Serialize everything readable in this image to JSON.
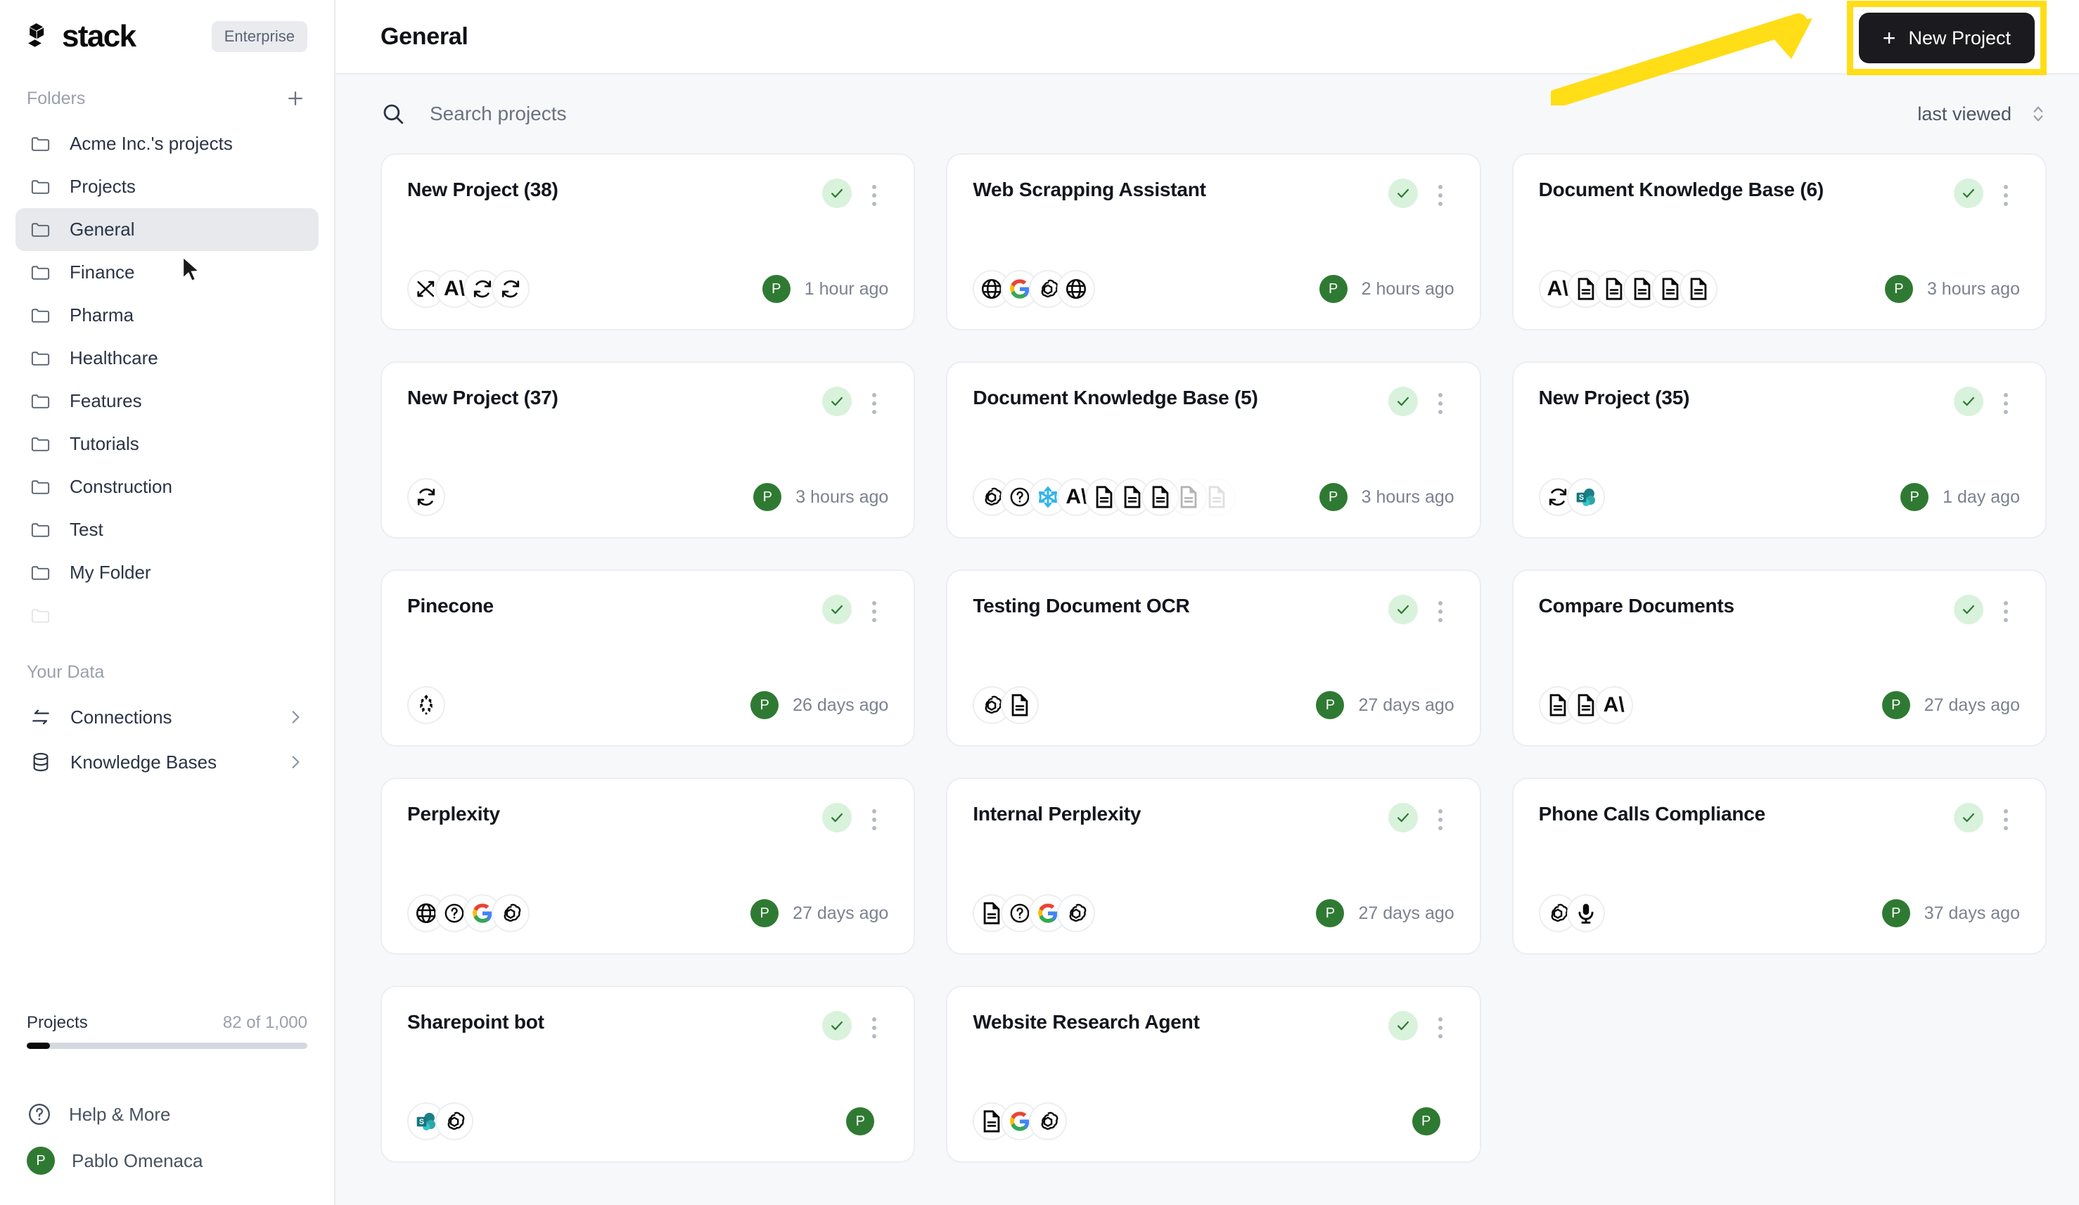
{
  "brand": {
    "name": "stack",
    "plan_badge": "Enterprise",
    "logo_icon": "stack-cubes-logo"
  },
  "sidebar": {
    "folders_label": "Folders",
    "add_folder_icon": "plus-icon",
    "folders": [
      {
        "label": "Acme Inc.'s projects",
        "icon": "folder-icon",
        "active": false
      },
      {
        "label": "Projects",
        "icon": "folder-icon",
        "active": false
      },
      {
        "label": "General",
        "icon": "folder-icon",
        "active": true
      },
      {
        "label": "Finance",
        "icon": "folder-icon",
        "active": false
      },
      {
        "label": "Pharma",
        "icon": "folder-icon",
        "active": false
      },
      {
        "label": "Healthcare",
        "icon": "folder-icon",
        "active": false
      },
      {
        "label": "Features",
        "icon": "folder-icon",
        "active": false
      },
      {
        "label": "Tutorials",
        "icon": "folder-icon",
        "active": false
      },
      {
        "label": "Construction",
        "icon": "folder-icon",
        "active": false
      },
      {
        "label": "Test",
        "icon": "folder-icon",
        "active": false
      },
      {
        "label": "My Folder",
        "icon": "folder-icon",
        "active": false
      }
    ],
    "your_data_label": "Your Data",
    "data_items": [
      {
        "label": "Connections",
        "icon": "arrows-exchange-icon",
        "chevron": "chevron-right-icon"
      },
      {
        "label": "Knowledge Bases",
        "icon": "database-icon",
        "chevron": "chevron-right-icon"
      }
    ],
    "quota": {
      "label": "Projects",
      "value": "82 of 1,000",
      "percent": 8.2
    },
    "help": {
      "label": "Help & More",
      "icon": "question-circle-icon"
    },
    "user": {
      "name": "Pablo Omenaca",
      "initial": "P",
      "avatar_color": "#2f7a32"
    }
  },
  "topbar": {
    "title": "General",
    "new_project_label": "New Project",
    "new_project_plus": "+",
    "highlight_color": "#FFDD17"
  },
  "toolbar": {
    "search_icon": "search-icon",
    "search_value": "",
    "search_placeholder": "Search projects",
    "sort_label": "last viewed",
    "sort_icon": "chevron-up-down-icon"
  },
  "status_badge_icon": "check-icon",
  "menu_icon": "three-dots-vertical-icon",
  "projects": [
    {
      "title": "New Project (38)",
      "timestamp": "1 hour ago",
      "owner_initial": "P",
      "icons": [
        "shuffle-icon",
        "anthropic-icon",
        "sync-icon",
        "sync-icon"
      ]
    },
    {
      "title": "Web Scrapping Assistant",
      "timestamp": "2 hours ago",
      "owner_initial": "P",
      "icons": [
        "globe-icon",
        "google-icon",
        "openai-icon",
        "globe-icon"
      ]
    },
    {
      "title": "Document Knowledge Base (6)",
      "timestamp": "3 hours ago",
      "owner_initial": "P",
      "icons": [
        "anthropic-icon",
        "document-icon",
        "document-icon",
        "document-icon",
        "document-icon",
        "document-icon"
      ]
    },
    {
      "title": "New Project (37)",
      "timestamp": "3 hours ago",
      "owner_initial": "P",
      "icons": [
        "sync-icon"
      ]
    },
    {
      "title": "Document Knowledge Base (5)",
      "timestamp": "3 hours ago",
      "owner_initial": "P",
      "icons": [
        "openai-icon",
        "question-icon",
        "snowflake-icon",
        "anthropic-icon",
        "document-icon",
        "document-icon",
        "document-icon",
        "document-icon-faded",
        "document-icon-faded2"
      ]
    },
    {
      "title": "New Project (35)",
      "timestamp": "1 day ago",
      "owner_initial": "P",
      "icons": [
        "sync-icon",
        "sharepoint-icon"
      ]
    },
    {
      "title": "Pinecone",
      "timestamp": "26 days ago",
      "owner_initial": "P",
      "icons": [
        "pinecone-icon"
      ]
    },
    {
      "title": "Testing Document OCR",
      "timestamp": "27 days ago",
      "owner_initial": "P",
      "icons": [
        "openai-icon",
        "document-icon"
      ]
    },
    {
      "title": "Compare Documents",
      "timestamp": "27 days ago",
      "owner_initial": "P",
      "icons": [
        "document-icon",
        "document-icon",
        "anthropic-icon"
      ]
    },
    {
      "title": "Perplexity",
      "timestamp": "27 days ago",
      "owner_initial": "P",
      "icons": [
        "globe-icon",
        "question-icon",
        "google-icon",
        "openai-icon"
      ]
    },
    {
      "title": "Internal Perplexity",
      "timestamp": "27 days ago",
      "owner_initial": "P",
      "icons": [
        "document-icon",
        "question-icon",
        "google-icon",
        "openai-icon"
      ]
    },
    {
      "title": "Phone Calls Compliance",
      "timestamp": "37 days ago",
      "owner_initial": "P",
      "icons": [
        "openai-icon",
        "microphone-icon"
      ]
    },
    {
      "title": "Sharepoint bot",
      "timestamp": "",
      "owner_initial": "P",
      "icons": [
        "sharepoint-icon",
        "openai-icon"
      ]
    },
    {
      "title": "Website Research Agent",
      "timestamp": "",
      "owner_initial": "P",
      "icons": [
        "document-icon",
        "google-icon",
        "openai-icon"
      ]
    }
  ],
  "annotation": {
    "arrow_icon": "yellow-arrow-pointing-to-new-project",
    "arrow_color": "#FFDD17"
  }
}
